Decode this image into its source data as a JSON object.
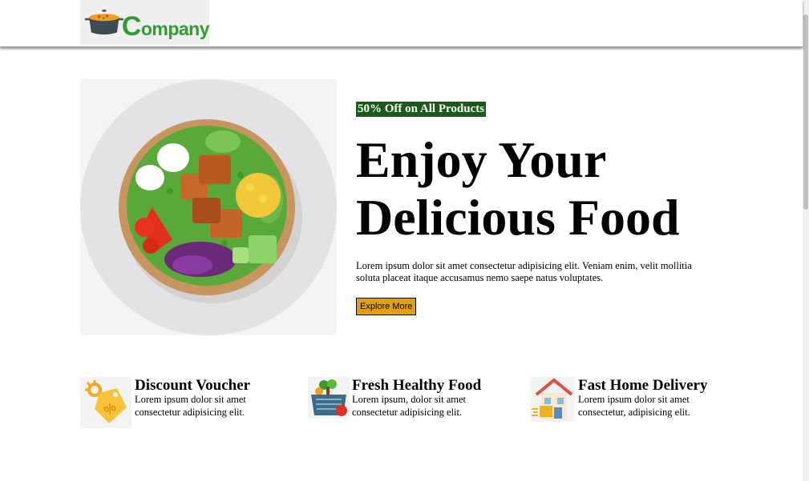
{
  "header": {
    "logo_text": "ompany",
    "logo_initial": "C"
  },
  "hero": {
    "badge": "50% Off on All Products",
    "title_line1": "Enjoy Your",
    "title_line2": "Delicious Food",
    "description": "Lorem ipsum dolor sit amet consectetur adipisicing elit. Veniam enim, velit mollitia soluta placeat itaque accusamus nemo saepe natus voluptates.",
    "button_label": "Explore More"
  },
  "features": [
    {
      "title": "Discount Voucher",
      "text": "Lorem ipsum dolor sit amet consectetur adipisicing elit.",
      "icon": "discount-tag-icon"
    },
    {
      "title": "Fresh Healthy Food",
      "text": "Lorem ipsum, dolor sit amet consectetur adipisicing elit.",
      "icon": "food-basket-icon"
    },
    {
      "title": "Fast Home Delivery",
      "text": "Lorem ipsum dolor sit amet consectetur, adipisicing elit.",
      "icon": "home-delivery-icon"
    }
  ],
  "colors": {
    "brand_green": "#2e9e2e",
    "badge_bg": "#1a5a1a",
    "button_bg": "#e0a010"
  }
}
